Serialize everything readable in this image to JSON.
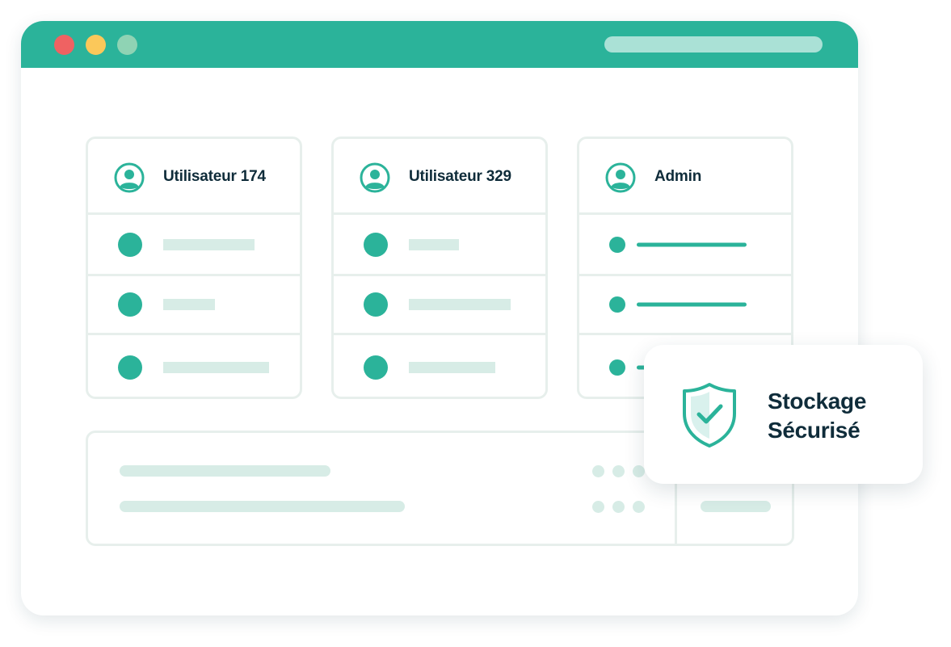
{
  "colors": {
    "accent": "#2bb39a",
    "placeholder": "#d7ece6",
    "border": "#e7efec",
    "text": "#0f2c3a",
    "traffic_red": "#ef6262",
    "traffic_yellow": "#fbc85a",
    "traffic_green": "#8fd3b4"
  },
  "window": {
    "traffic_lights": [
      "close",
      "minimize",
      "maximize"
    ]
  },
  "cards": [
    {
      "title": "Utilisateur 174",
      "icon": "user-avatar-icon",
      "row_fill": [
        0.42,
        0.24,
        0.49
      ]
    },
    {
      "title": "Utilisateur 329",
      "icon": "user-avatar-icon",
      "row_fill": [
        0.23,
        0.47,
        0.4
      ]
    },
    {
      "title": "Admin",
      "icon": "user-avatar-icon",
      "row_fill": [
        1,
        1,
        1
      ]
    }
  ],
  "badge": {
    "icon": "shield-check-icon",
    "line1": "Stockage",
    "line2": "Sécurisé"
  }
}
